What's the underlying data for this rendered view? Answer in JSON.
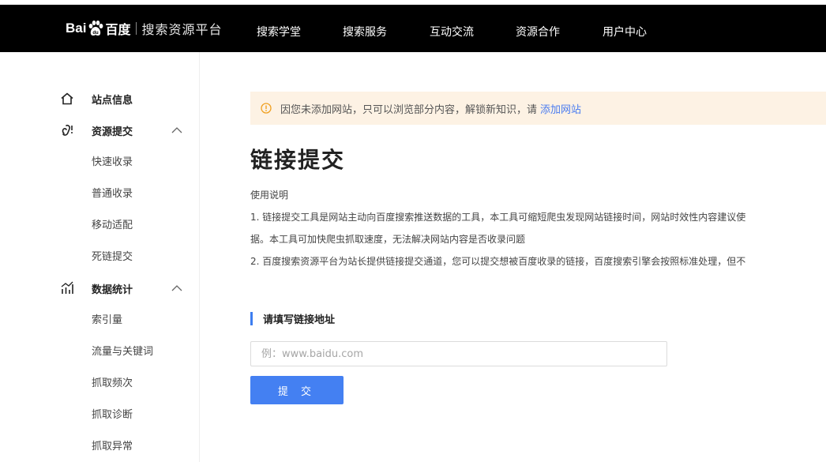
{
  "brand": {
    "logo_text_bai": "Bai",
    "logo_text_du": "百度",
    "platform": "搜索资源平台",
    "logo_paw_icon": "baidu-paw-icon"
  },
  "nav": {
    "items": [
      "搜索学堂",
      "搜索服务",
      "互动交流",
      "资源合作",
      "用户中心"
    ]
  },
  "sidebar": {
    "site_info": {
      "label": "站点信息",
      "icon": "home-icon"
    },
    "resource_submit": {
      "label": "资源提交",
      "icon": "link-icon",
      "expanded": true,
      "children": [
        "快速收录",
        "普通收录",
        "移动适配",
        "死链提交"
      ]
    },
    "data_stats": {
      "label": "数据统计",
      "icon": "stats-icon",
      "expanded": true,
      "children": [
        "索引量",
        "流量与关键词",
        "抓取频次",
        "抓取诊断",
        "抓取异常"
      ]
    }
  },
  "notice": {
    "icon": "warning-circle-icon",
    "text": "因您未添加网站，只可以浏览部分内容，解锁新知识，请",
    "link": "添加网站"
  },
  "main": {
    "title": "链接提交",
    "usage_title": "使用说明",
    "usage_lines": [
      "1. 链接提交工具是网站主动向百度搜索推送数据的工具，本工具可缩短爬虫发现网站链接时间，网站时效性内容建议使",
      "据。本工具可加快爬虫抓取速度，无法解决网站内容是否收录问题",
      "2. 百度搜索资源平台为站长提供链接提交通道，您可以提交想被百度收录的链接，百度搜索引擎会按照标准处理，但不"
    ],
    "section_label": "请填写链接地址",
    "input_value": "",
    "input_placeholder": "例：www.baidu.com",
    "submit_label": "提 交"
  },
  "colors": {
    "navbar_bg": "#000000",
    "accent": "#4480f2",
    "notice_bg": "#fdf2e4",
    "warning": "#f0a020"
  }
}
